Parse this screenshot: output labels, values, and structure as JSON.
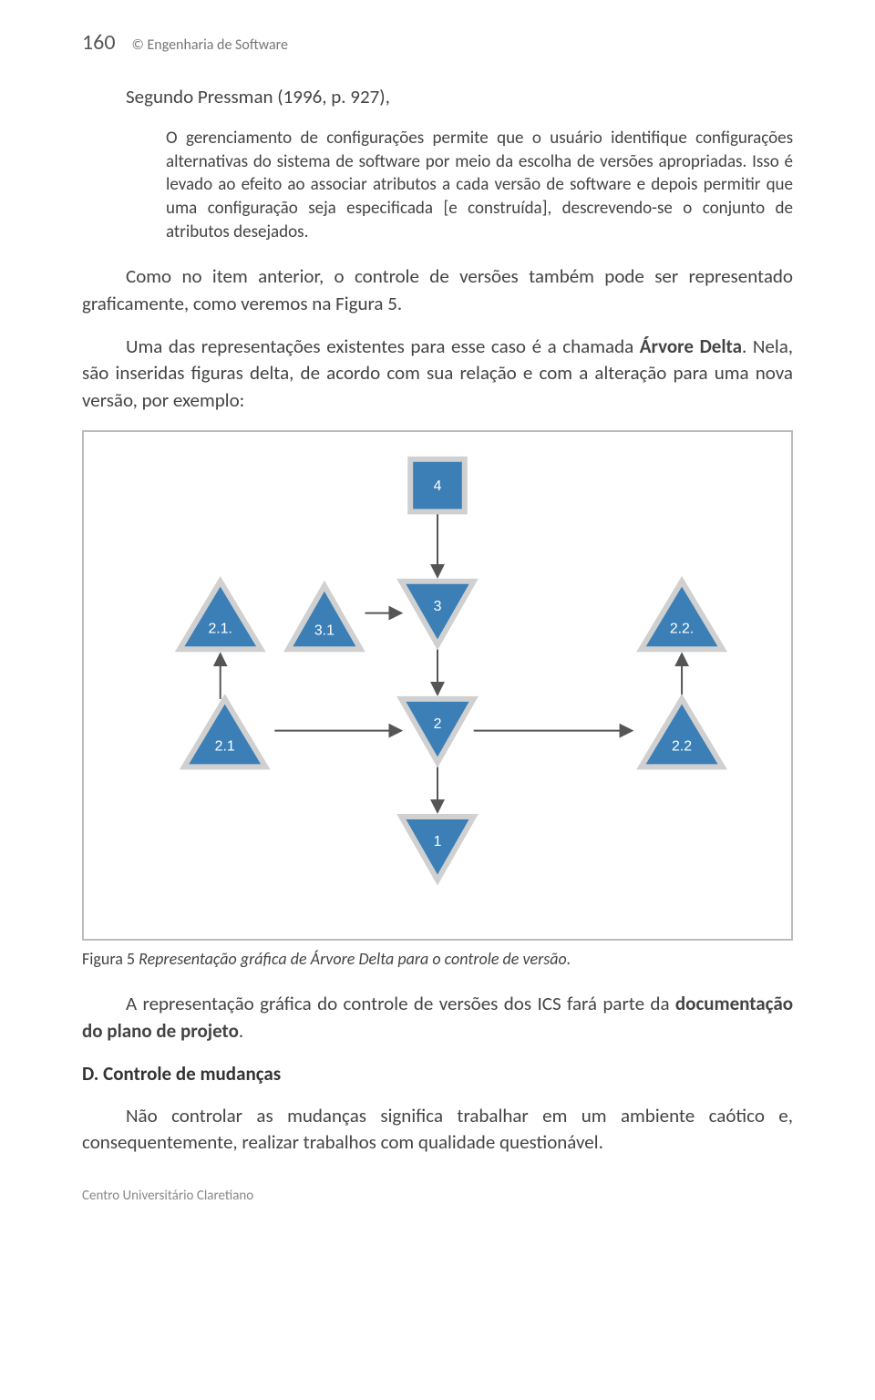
{
  "header": {
    "page_number": "160",
    "running_title": "© Engenharia de Software"
  },
  "quote_intro": "Segundo Pressman (1996, p. 927),",
  "quote_body": "O gerenciamento de configurações permite que o usuário identifique configurações alternativas do sistema de software por meio da escolha de versões apropriadas. Isso é levado ao efeito ao associar atributos a cada versão de software e depois permitir que uma configuração seja especificada [e construída], descrevendo-se o conjunto de atributos desejados.",
  "p1": "Como no item anterior, o controle de versões também pode ser representado graficamente, como veremos na Figura 5.",
  "p2_a": "Uma das representações existentes para esse caso é a chamada ",
  "p2_b": "Árvore Delta",
  "p2_c": ". Nela, são inseridas figuras delta, de acordo com sua relação e com a alteração para uma nova versão, por exemplo:",
  "diagram": {
    "nodes": {
      "n4": "4",
      "n3": "3",
      "n2": "2",
      "n1": "1",
      "n21a": "2.1.",
      "n31": "3.1",
      "n22a": "2.2.",
      "n21b": "2.1",
      "n22b": "2.2"
    }
  },
  "figure_caption_num": "Figura 5 ",
  "figure_caption_txt": "Representação gráfica de Árvore Delta para o controle de versão.",
  "p3_a": "A representação gráfica do controle de versões dos ICS fará parte da ",
  "p3_b": "documentação do plano de projeto",
  "p3_c": ".",
  "section_d": "D. Controle de mudanças",
  "p4": "Não controlar as mudanças significa trabalhar em um ambiente caótico e, consequentemente, realizar trabalhos com qualidade questionável.",
  "footer": "Centro Universitário Claretiano"
}
